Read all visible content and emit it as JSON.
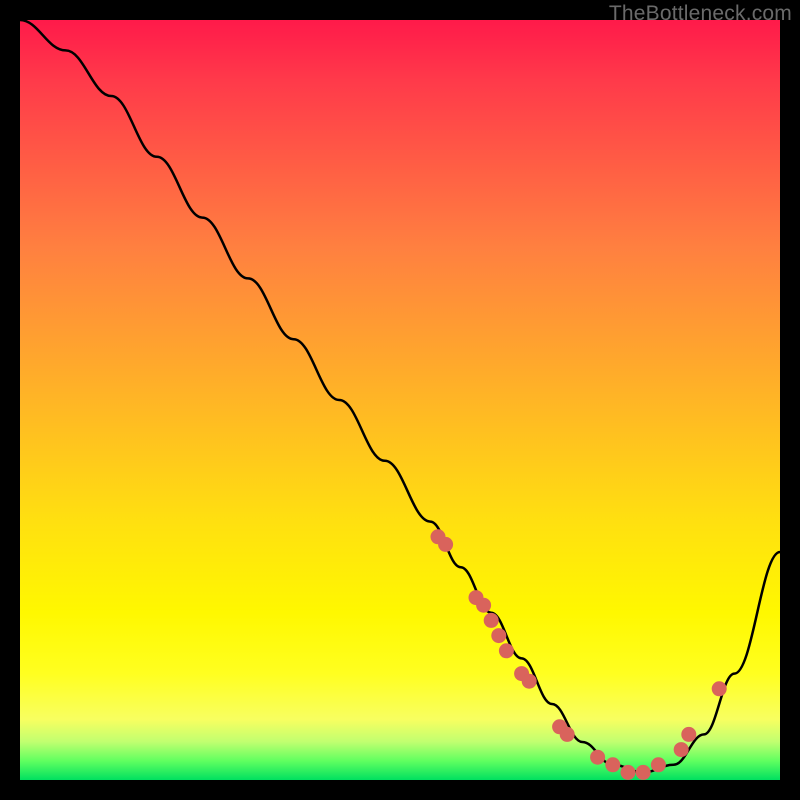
{
  "watermark": "TheBottleneck.com",
  "chart_data": {
    "type": "line",
    "title": "",
    "xlabel": "",
    "ylabel": "",
    "xlim": [
      0,
      100
    ],
    "ylim": [
      0,
      100
    ],
    "series": [
      {
        "name": "curve",
        "x": [
          0,
          6,
          12,
          18,
          24,
          30,
          36,
          42,
          48,
          54,
          58,
          62,
          66,
          70,
          74,
          78,
          82,
          86,
          90,
          94,
          100
        ],
        "y": [
          100,
          96,
          90,
          82,
          74,
          66,
          58,
          50,
          42,
          34,
          28,
          22,
          16,
          10,
          5,
          2,
          1,
          2,
          6,
          14,
          30
        ]
      }
    ],
    "points": [
      {
        "x": 55,
        "y": 32
      },
      {
        "x": 56,
        "y": 31
      },
      {
        "x": 60,
        "y": 24
      },
      {
        "x": 61,
        "y": 23
      },
      {
        "x": 62,
        "y": 21
      },
      {
        "x": 63,
        "y": 19
      },
      {
        "x": 64,
        "y": 17
      },
      {
        "x": 66,
        "y": 14
      },
      {
        "x": 67,
        "y": 13
      },
      {
        "x": 71,
        "y": 7
      },
      {
        "x": 72,
        "y": 6
      },
      {
        "x": 76,
        "y": 3
      },
      {
        "x": 78,
        "y": 2
      },
      {
        "x": 80,
        "y": 1
      },
      {
        "x": 82,
        "y": 1
      },
      {
        "x": 84,
        "y": 2
      },
      {
        "x": 87,
        "y": 4
      },
      {
        "x": 88,
        "y": 6
      },
      {
        "x": 92,
        "y": 12
      }
    ],
    "background_gradient": {
      "top": "#ff1a4a",
      "mid": "#ffe010",
      "bottom": "#00e060"
    }
  }
}
